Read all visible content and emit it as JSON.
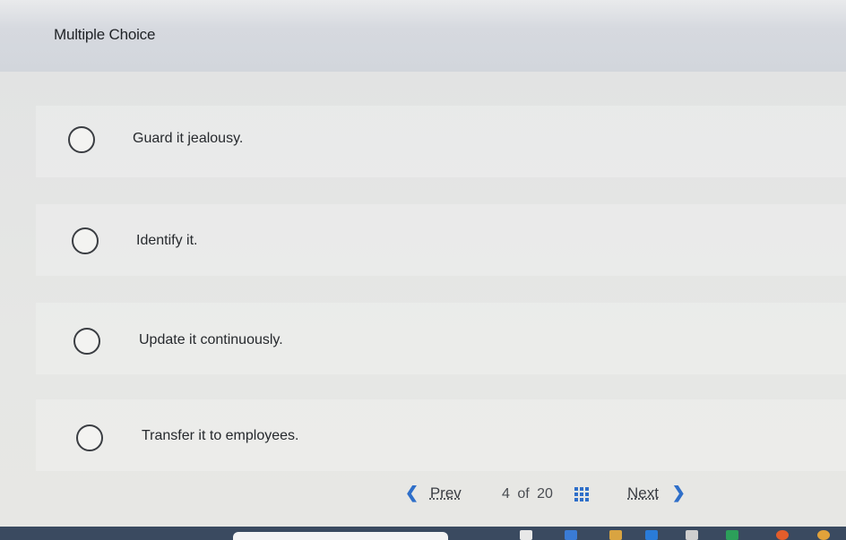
{
  "header": {
    "title": "Multiple Choice"
  },
  "options": [
    {
      "label": "Guard it jealousy."
    },
    {
      "label": "Identify it."
    },
    {
      "label": "Update it continuously."
    },
    {
      "label": "Transfer it to employees."
    }
  ],
  "nav": {
    "prev_label": "Prev",
    "next_label": "Next",
    "current": "4",
    "of_label": "of",
    "total": "20"
  },
  "colors": {
    "accent": "#2f6fc9",
    "header_bg": "#d4d8de",
    "text": "#26292d"
  },
  "icons": [
    "radio-button-icon",
    "chevron-left-icon",
    "grid-icon",
    "chevron-right-icon"
  ]
}
